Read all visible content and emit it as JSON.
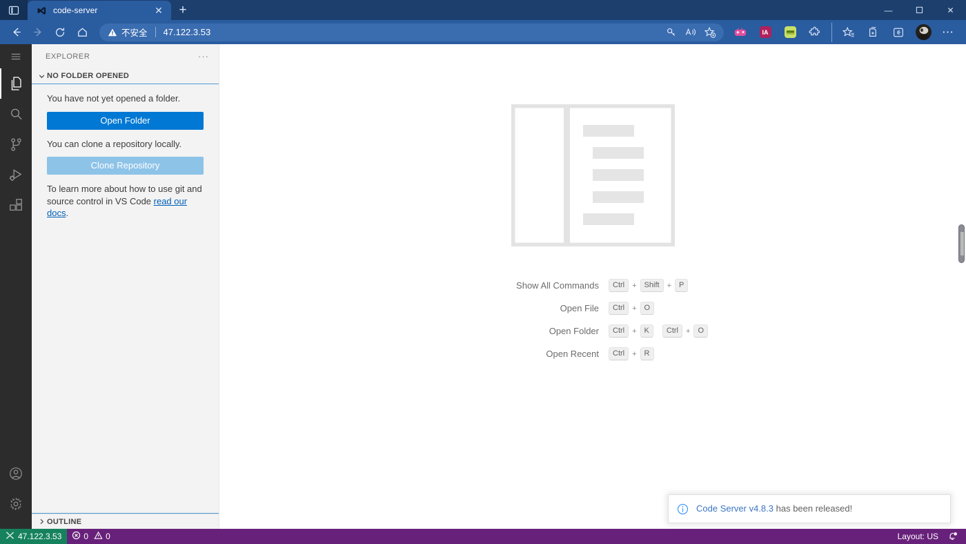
{
  "browser": {
    "tab": {
      "title": "code-server",
      "favicon_name": "code-server-logo-icon",
      "close_label": "✕"
    },
    "new_tab_label": "+",
    "window_controls": {
      "minimize": "—",
      "maximize": "❐",
      "close": "✕"
    },
    "nav": {
      "back": "←",
      "forward": "→",
      "reload": "⟳",
      "home": "⌂"
    },
    "omnibox": {
      "security_label": "不安全",
      "url": "47.122.3.53",
      "separator": "|",
      "actions": [
        "key-icon",
        "read-aloud-icon",
        "add-favorite-icon"
      ]
    },
    "toolbar_extensions": [
      {
        "name": "game-extension-icon",
        "label": "",
        "color": "#e5509f"
      },
      {
        "name": "internet-archive-extension-icon",
        "label": "IA",
        "color": "#b0215c"
      },
      {
        "name": "green-note-extension-icon",
        "label": "",
        "color": "#c8e06a"
      },
      {
        "name": "puzzle-extension-icon",
        "label": "",
        "color": "#ffffff"
      },
      {
        "name": "collections-icon",
        "label": "",
        "color": "#ffffff"
      },
      {
        "name": "browser-essentials-icon",
        "label": "",
        "color": "#ffffff"
      },
      {
        "name": "split-screen-icon",
        "label": "",
        "color": "#ffffff"
      }
    ],
    "favorites_label": "favorites-icon",
    "profile_label": "profile-avatar",
    "settings_more_label": "⋯"
  },
  "vscode": {
    "activity_bar": [
      {
        "name": "menu-icon",
        "label": "Menu",
        "active": false
      },
      {
        "name": "explorer-icon",
        "label": "Explorer",
        "active": true
      },
      {
        "name": "search-icon",
        "label": "Search",
        "active": false
      },
      {
        "name": "source-control-icon",
        "label": "Source Control",
        "active": false
      },
      {
        "name": "run-debug-icon",
        "label": "Run and Debug",
        "active": false
      },
      {
        "name": "extensions-icon",
        "label": "Extensions",
        "active": false
      }
    ],
    "activity_bar_bottom": [
      {
        "name": "accounts-icon",
        "label": "Accounts"
      },
      {
        "name": "manage-settings-icon",
        "label": "Manage"
      }
    ],
    "sidebar": {
      "title": "EXPLORER",
      "more_actions": "···",
      "section": {
        "header": "NO FOLDER OPENED",
        "paragraph_1": "You have not yet opened a folder.",
        "open_folder_button": "Open Folder",
        "paragraph_2": "You can clone a repository locally.",
        "clone_repository_button": "Clone Repository",
        "paragraph_3_prefix": "To learn more about how to use git and source control in VS Code ",
        "paragraph_3_link": "read our docs",
        "paragraph_3_suffix": "."
      },
      "outline_header": "OUTLINE"
    },
    "editor": {
      "watermark_name": "letterpress-placeholder-image",
      "shortcuts": [
        {
          "label": "Show All Commands",
          "chords": [
            [
              "Ctrl",
              "Shift",
              "P"
            ]
          ]
        },
        {
          "label": "Open File",
          "chords": [
            [
              "Ctrl",
              "O"
            ]
          ]
        },
        {
          "label": "Open Folder",
          "chords": [
            [
              "Ctrl",
              "K"
            ],
            [
              "Ctrl",
              "O"
            ]
          ]
        },
        {
          "label": "Open Recent",
          "chords": [
            [
              "Ctrl",
              "R"
            ]
          ]
        }
      ],
      "key_separator": "+"
    },
    "notification": {
      "icon": "info-icon",
      "highlight": "Code Server v4.8.3",
      "message": " has been released!"
    },
    "status_bar": {
      "remote_icon": "remote-host-icon",
      "remote_label": "47.122.3.53",
      "errors_icon": "error-icon",
      "errors_count": "0",
      "warnings_icon": "warning-icon",
      "warnings_count": "0",
      "layout_label": "Layout: US",
      "bell_icon": "notifications-bell-dot-icon"
    }
  },
  "colors": {
    "browser_chrome": "#2a5ca0",
    "tabstrip": "#1c3f6e",
    "accent_blue": "#0078d4",
    "status_purple": "#68217a",
    "remote_green": "#16825d",
    "activity_bar": "#2c2c2c",
    "sidebar": "#f3f3f3"
  }
}
